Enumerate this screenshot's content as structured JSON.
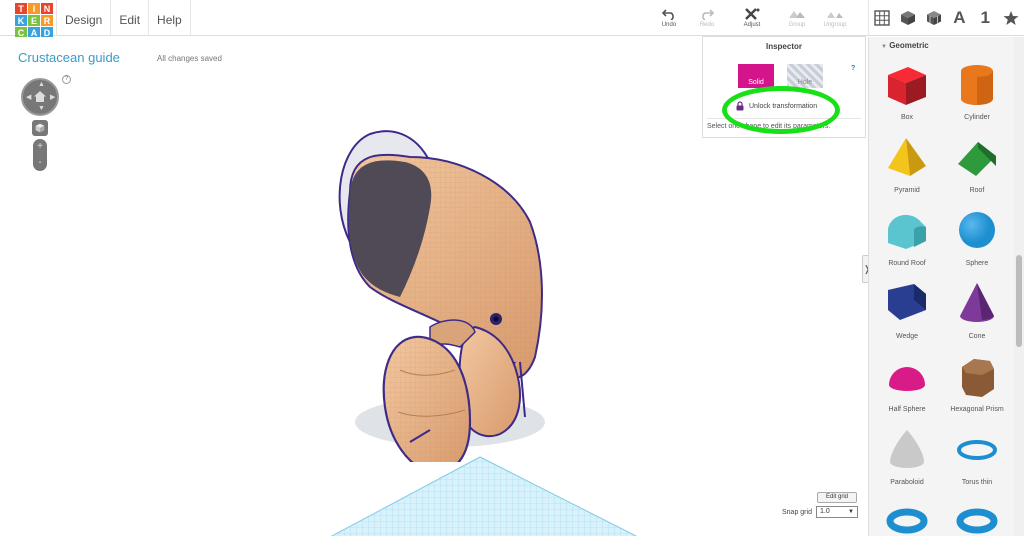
{
  "logo": {
    "letters": [
      "T",
      "I",
      "N",
      "K",
      "E",
      "R",
      "C",
      "A",
      "D"
    ],
    "colors": [
      "#e8452f",
      "#f89b26",
      "#e8452f",
      "#3aa3dd",
      "#7dc142",
      "#f89b26",
      "#7dc142",
      "#3aa3dd",
      "#3aa3dd"
    ]
  },
  "menu": {
    "design": "Design",
    "edit": "Edit",
    "help": "Help"
  },
  "toolbar": {
    "undo": "Undo",
    "redo": "Redo",
    "adjust": "Adjust",
    "group": "Group",
    "ungroup": "Ungroup"
  },
  "right_toolbar": {
    "letter_a": "A",
    "number_one": "1"
  },
  "project": {
    "title": "Crustacean guide",
    "status": "All changes saved"
  },
  "view_controls": {
    "help": "?",
    "zoom_in": "+",
    "zoom_out": "-"
  },
  "inspector": {
    "title": "Inspector",
    "help": "?",
    "solid_label": "Solid",
    "hole_label": "Hole",
    "unlock_label": "Unlock transformation",
    "hint": "Select one shape to edit its parameters."
  },
  "grid": {
    "edit_label": "Edit grid",
    "snap_label": "Snap grid",
    "snap_value": "1.0"
  },
  "panel": {
    "collapse_glyph": "❭",
    "category": "Geometric",
    "shapes": [
      {
        "label": "Box",
        "color": "#d9242f"
      },
      {
        "label": "Cylinder",
        "color": "#e9771c"
      },
      {
        "label": "Pyramid",
        "color": "#f3c51b"
      },
      {
        "label": "Roof",
        "color": "#2e9a3c"
      },
      {
        "label": "Round Roof",
        "color": "#5bc5cf"
      },
      {
        "label": "Sphere",
        "color": "#1d8fd0"
      },
      {
        "label": "Wedge",
        "color": "#2a3e91"
      },
      {
        "label": "Cone",
        "color": "#7d3a9a"
      },
      {
        "label": "Half Sphere",
        "color": "#d81b86"
      },
      {
        "label": "Hexagonal Prism",
        "color": "#8a5a36"
      },
      {
        "label": "Paraboloid",
        "color": "#c9c9c9"
      },
      {
        "label": "Torus thin",
        "color": "#1d8fd0"
      }
    ]
  }
}
